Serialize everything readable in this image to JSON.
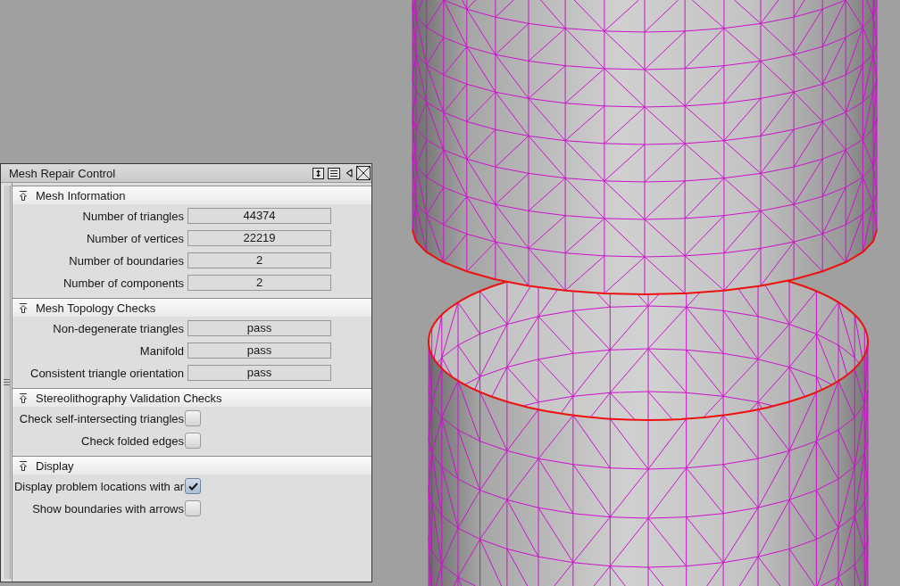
{
  "panel": {
    "title": "Mesh Repair Control"
  },
  "sections": [
    {
      "title": "Mesh Information",
      "expanded": true,
      "rows": [
        {
          "kind": "field",
          "label": "Number of triangles",
          "value": "44374"
        },
        {
          "kind": "field",
          "label": "Number of vertices",
          "value": "22219"
        },
        {
          "kind": "field",
          "label": "Number of boundaries",
          "value": "2"
        },
        {
          "kind": "field",
          "label": "Number of components",
          "value": "2"
        }
      ]
    },
    {
      "title": "Mesh Topology Checks",
      "expanded": true,
      "rows": [
        {
          "kind": "field",
          "label": "Non-degenerate triangles",
          "value": "pass"
        },
        {
          "kind": "field",
          "label": "Manifold",
          "value": "pass"
        },
        {
          "kind": "field",
          "label": "Consistent triangle orientation",
          "value": "pass"
        }
      ]
    },
    {
      "title": "Stereolithography Validation Checks",
      "expanded": true,
      "rows": [
        {
          "kind": "checkbox",
          "label": "Check self-intersecting triangles",
          "checked": false
        },
        {
          "kind": "checkbox",
          "label": "Check folded edges",
          "checked": false
        }
      ]
    },
    {
      "title": "Display",
      "expanded": true,
      "rows": [
        {
          "kind": "checkbox",
          "label": "Display problem locations with ar",
          "checked": true
        },
        {
          "kind": "checkbox",
          "label": "Show boundaries with arrows",
          "checked": false
        }
      ]
    }
  ]
}
